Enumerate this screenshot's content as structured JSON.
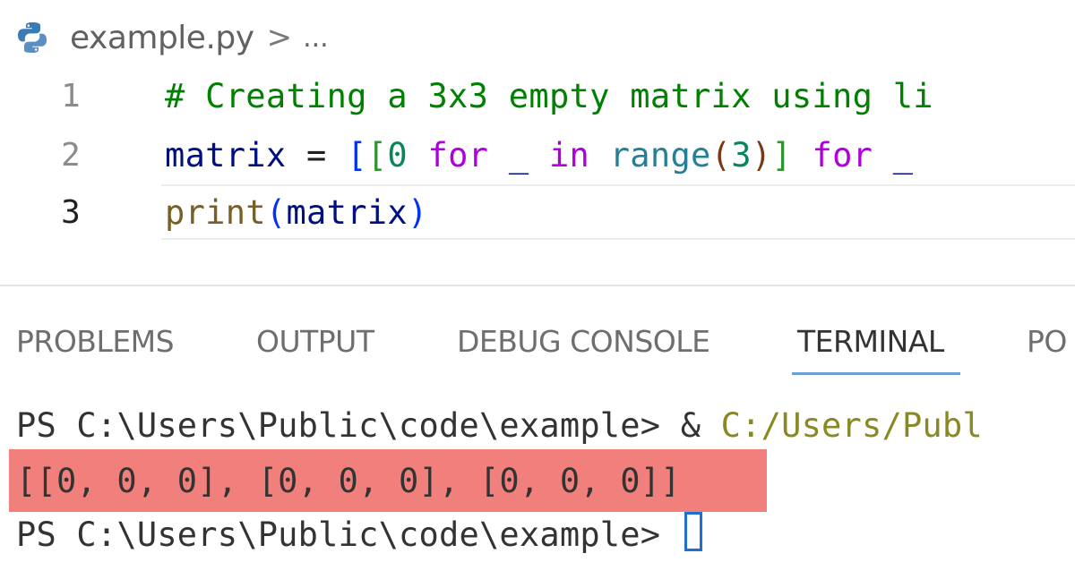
{
  "breadcrumb": {
    "file_icon": "python-file-icon",
    "file_name": "example.py",
    "separator": ">",
    "more": "..."
  },
  "editor": {
    "lines": [
      {
        "number": "1",
        "comment": "# Creating a 3x3 empty matrix using li"
      },
      {
        "number": "2",
        "var": "matrix",
        "eq": " = ",
        "b1": "[",
        "b2": "[",
        "zero": "0",
        "for1": "for",
        "under1": " _ ",
        "in1": "in",
        "range": "range",
        "paren_open": "(",
        "three": "3",
        "paren_close": ")",
        "b2c": "]",
        "for2": "for",
        "under2": " _ "
      },
      {
        "number": "3",
        "print": "print",
        "paren_open": "(",
        "arg": "matrix",
        "paren_close": ")"
      }
    ]
  },
  "panel": {
    "tabs": [
      {
        "label": "PROBLEMS"
      },
      {
        "label": "OUTPUT"
      },
      {
        "label": "DEBUG CONSOLE"
      },
      {
        "label": "TERMINAL"
      },
      {
        "label": "PO"
      }
    ],
    "active_tab": "TERMINAL"
  },
  "terminal": {
    "line1_prompt": "PS C:\\Users\\Public\\code\\example> ",
    "line1_amp": "& ",
    "line1_path": "C:/Users/Publ",
    "output": "[[0, 0, 0], [0, 0, 0], [0, 0, 0]]",
    "line3_prompt": "PS C:\\Users\\Public\\code\\example> "
  },
  "colors": {
    "output_highlight": "#f1807c",
    "active_tab_underline": "#6aa0d6",
    "comment": "#008000",
    "keyword": "#af00db"
  }
}
